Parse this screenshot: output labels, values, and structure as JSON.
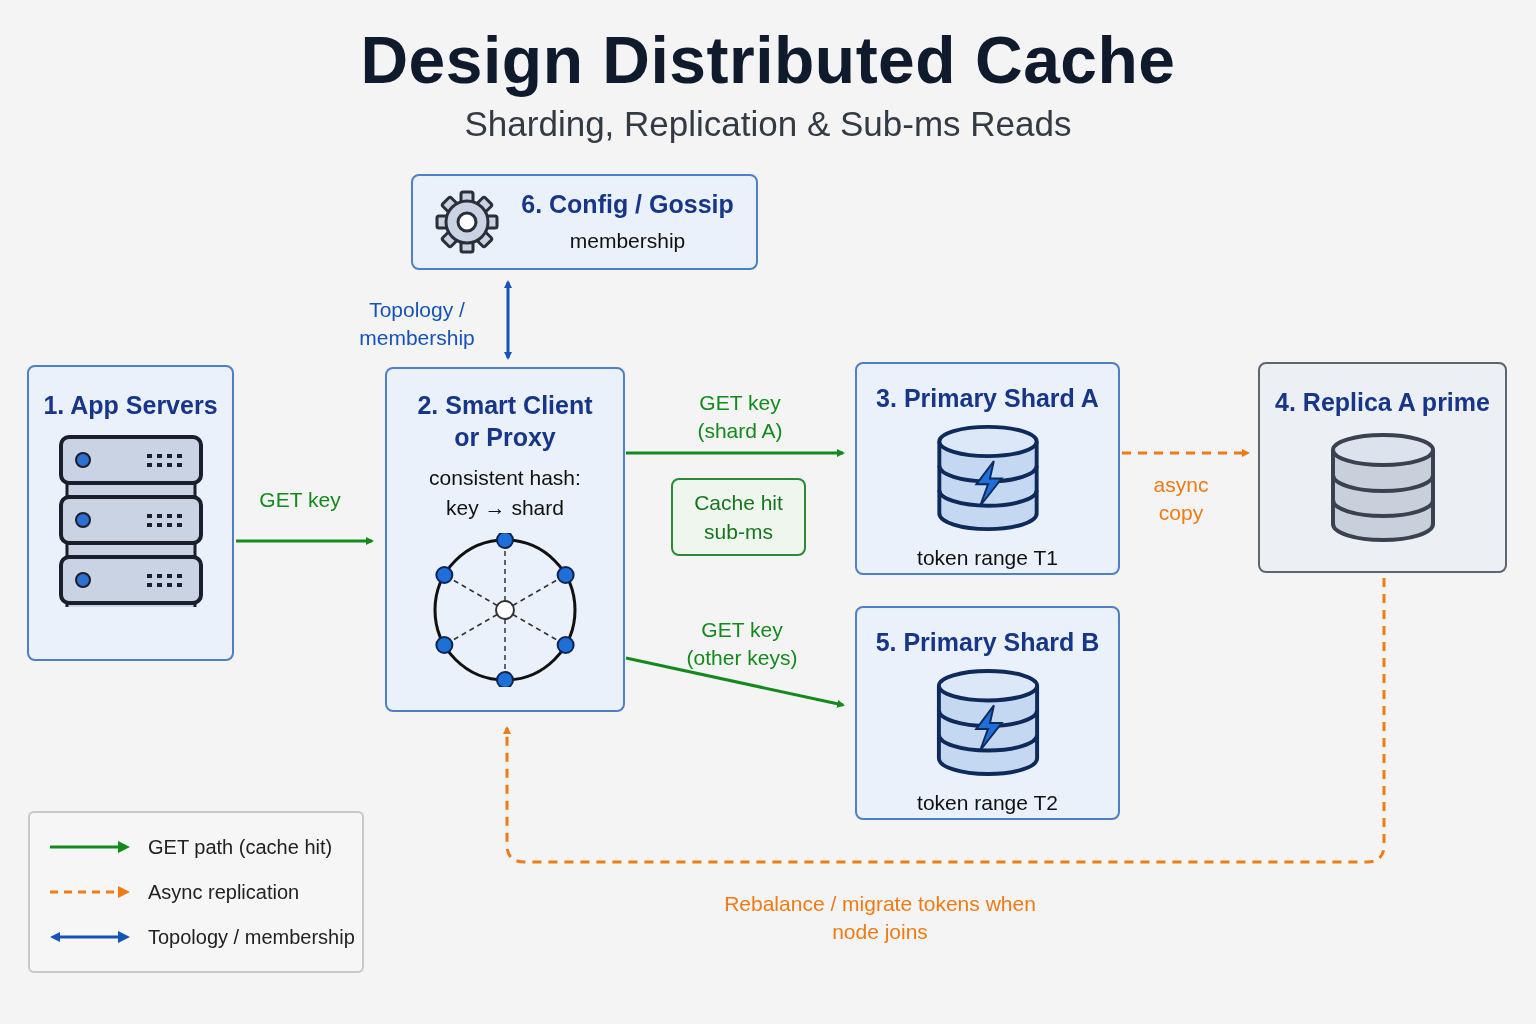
{
  "title": "Design Distributed Cache",
  "subtitle": "Sharding, Replication & Sub-ms Reads",
  "nodes": [
    {
      "kind": "app",
      "title": "1. App Servers"
    },
    {
      "kind": "client",
      "title": "2. Smart Client or Proxy",
      "text": "consistent hash: key → shard"
    },
    {
      "kind": "shard",
      "title": "3. Primary Shard A",
      "text": "token range T1"
    },
    {
      "kind": "replica",
      "title": "4. Replica A prime"
    },
    {
      "kind": "shard",
      "title": "5. Primary Shard B",
      "text": "token range T2"
    },
    {
      "kind": "config",
      "title": "6. Config / Gossip",
      "text": "membership"
    }
  ],
  "note": {
    "text": "Cache hit sub-ms"
  },
  "edges": [
    {
      "kind": "get",
      "label": "GET key"
    },
    {
      "kind": "get",
      "label": "GET key (shard A)"
    },
    {
      "kind": "get",
      "label": "GET key (other keys)"
    },
    {
      "kind": "async",
      "label": "async copy"
    },
    {
      "kind": "topology",
      "label": "Topology / membership"
    },
    {
      "kind": "async",
      "label": "Rebalance / migrate tokens when node joins"
    }
  ],
  "legend": [
    {
      "kind": "get",
      "label": "GET path (cache hit)"
    },
    {
      "kind": "async",
      "label": "Async replication"
    },
    {
      "kind": "topology",
      "label": "Topology / membership"
    }
  ]
}
